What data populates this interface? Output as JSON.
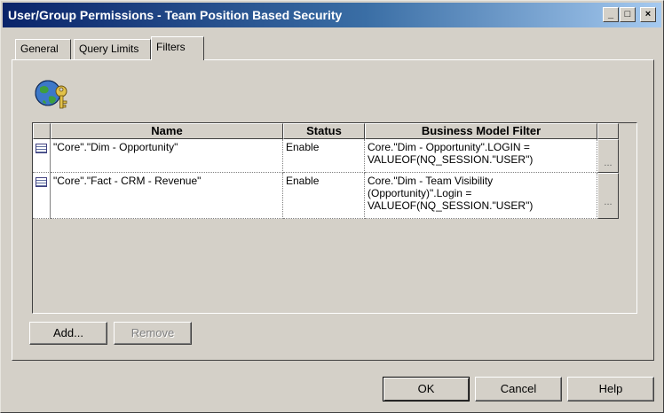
{
  "window": {
    "title": "User/Group Permissions - Team Position Based Security",
    "minimize": "_",
    "maximize": "□",
    "close": "×"
  },
  "tabs": [
    "General",
    "Query Limits",
    "Filters"
  ],
  "active_tab": "Filters",
  "icons": {
    "header": "globe-key-icon",
    "row": "table-icon"
  },
  "table": {
    "columns": [
      "Name",
      "Status",
      "Business Model Filter"
    ],
    "rows": [
      {
        "name": "\"Core\".\"Dim - Opportunity\"",
        "status": "Enable",
        "filter_lines": [
          "Core.\"Dim - Opportunity\".LOGIN =",
          "VALUEOF(NQ_SESSION.\"USER\")"
        ],
        "ellipsis": "..."
      },
      {
        "name": "\"Core\".\"Fact - CRM - Revenue\"",
        "status": "Enable",
        "filter_lines": [
          "Core.\"Dim - Team Visibility",
          "(Opportunity)\".Login =",
          "VALUEOF(NQ_SESSION.\"USER\")"
        ],
        "ellipsis": "..."
      }
    ]
  },
  "buttons": {
    "add": "Add...",
    "remove": "Remove",
    "ok": "OK",
    "cancel": "Cancel",
    "help": "Help"
  }
}
